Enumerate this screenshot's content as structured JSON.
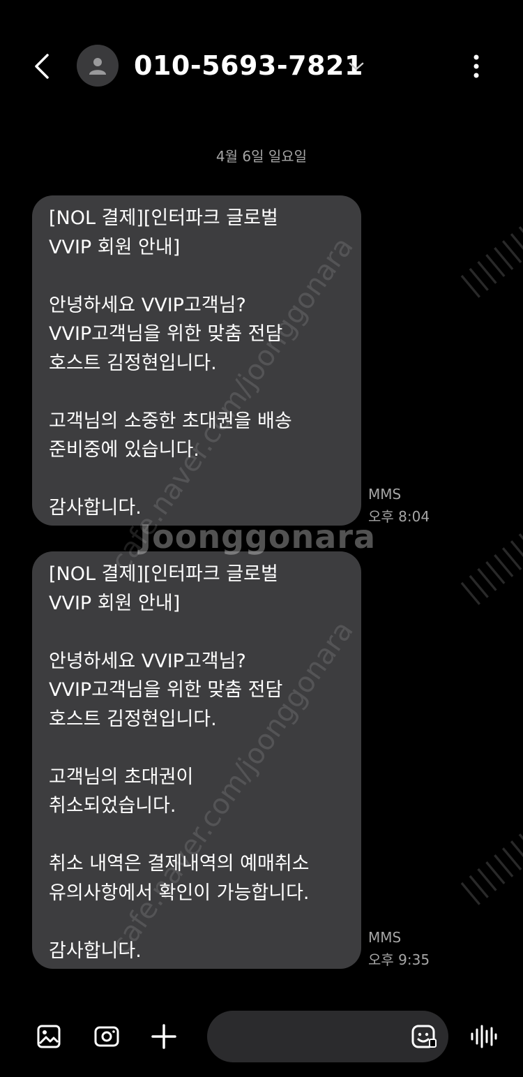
{
  "header": {
    "contact_number": "010-5693-7821",
    "back_icon": "chevron-left-icon",
    "avatar_icon": "person-icon",
    "dropdown_icon": "chevron-down-icon",
    "more_icon": "more-vertical-icon"
  },
  "conversation": {
    "date_label": "4월 6일 일요일",
    "messages": [
      {
        "text": "[NOL 결제][인터파크 글로벌\nVVIP 회원 안내]\n\n안녕하세요 VVIP고객님?\nVVIP고객님을 위한 맞춤 전담\n호스트 김정현입니다.\n\n고객님의 소중한 초대권을 배송\n준비중에 있습니다.\n\n감사합니다.",
        "type": "MMS",
        "time": "오후 8:04"
      },
      {
        "text": "[NOL 결제][인터파크 글로벌\nVVIP 회원 안내]\n\n안녕하세요 VVIP고객님?\nVVIP고객님을 위한 맞춤 전담\n호스트 김정현입니다.\n\n고객님의 초대권이\n취소되었습니다.\n\n취소 내역은 결제내역의 예매취소\n유의사항에서 확인이 가능합니다.\n\n감사합니다.",
        "type": "MMS",
        "time": "오후 9:35"
      }
    ]
  },
  "watermark": {
    "brand": "Joonggonara",
    "url": "cafe.naver.com/joonggonara",
    "bars": "||||||||||"
  },
  "composer": {
    "gallery_icon": "gallery-icon",
    "camera_icon": "camera-icon",
    "plus_icon": "plus-icon",
    "emoji_icon": "emoji-icon",
    "voice_icon": "voice-wave-icon"
  },
  "colors": {
    "background": "#000000",
    "bubble": "#3d3d3f",
    "meta_text": "#a6a6a6",
    "input_pill": "#2b2b2d"
  }
}
